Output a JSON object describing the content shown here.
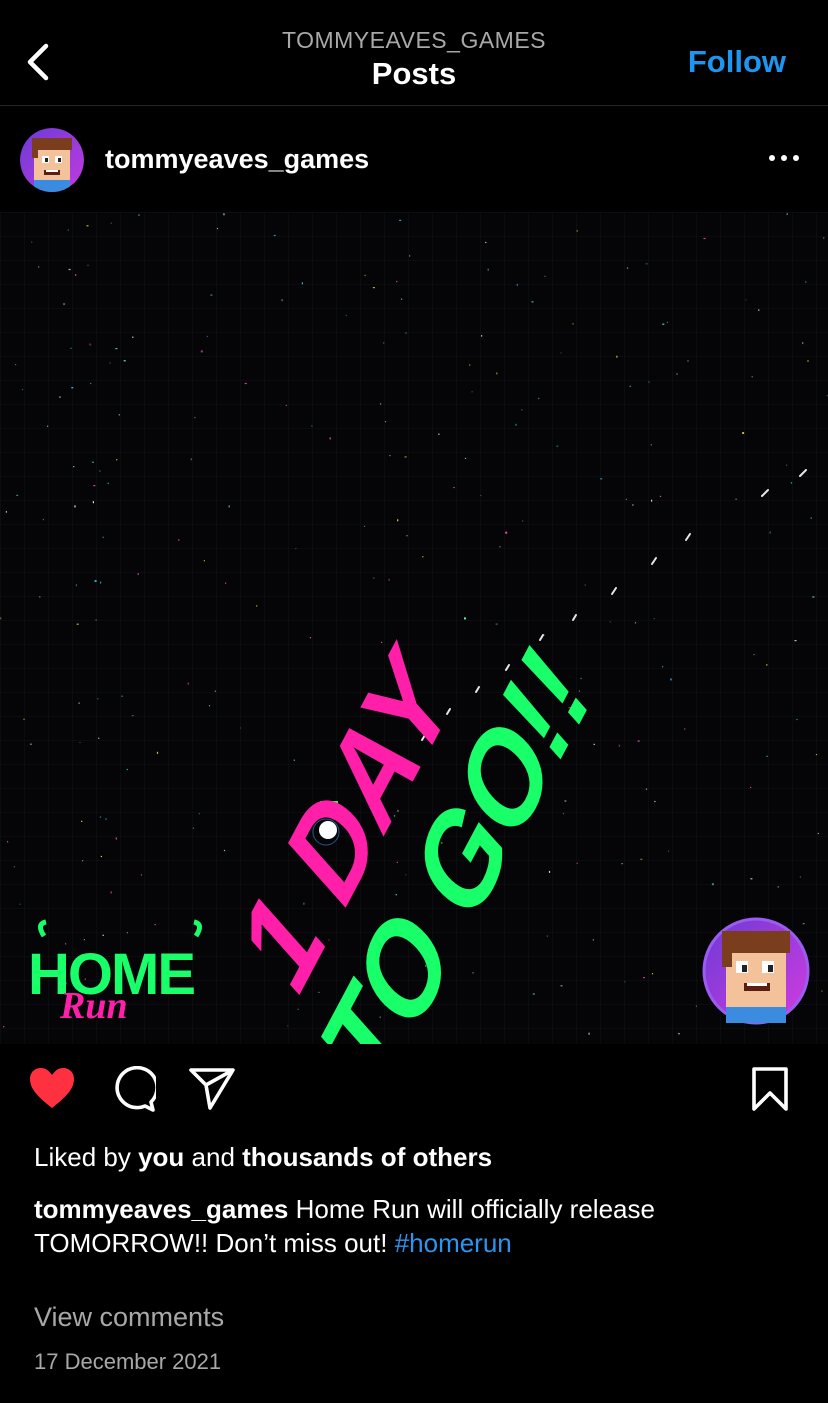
{
  "header": {
    "account": "TOMMYEAVES_GAMES",
    "title": "Posts",
    "follow_label": "Follow"
  },
  "post": {
    "username": "tommyeaves_games",
    "image": {
      "headline_line1": "1 DAY",
      "headline_line2": "TO GO!!",
      "logo_text": "HOME",
      "logo_script": "Run",
      "colors": {
        "pink": "#ff1fa8",
        "green": "#19ff6a",
        "background": "#050507"
      }
    },
    "likes": {
      "prefix": "Liked by ",
      "you": "you",
      "and": " and ",
      "others": "thousands of others"
    },
    "caption": {
      "username": "tommyeaves_games",
      "text": " Home Run will officially release TOMORROW!! Don’t miss out! ",
      "hashtag": "#homerun"
    },
    "view_comments": "View comments",
    "date": "17 December 2021",
    "liked": true
  },
  "icons": {
    "back": "chevron-left-icon",
    "more": "more-horizontal-icon",
    "like": "heart-icon",
    "comment": "comment-icon",
    "share": "paper-plane-icon",
    "save": "bookmark-icon"
  },
  "colors": {
    "accent": "#1f95f2",
    "like": "#ff3040",
    "secondary_text": "#a8a8a8"
  }
}
